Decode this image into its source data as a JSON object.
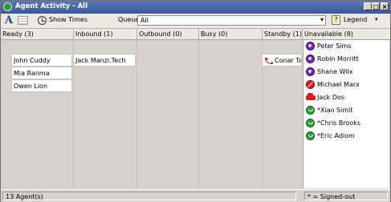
{
  "window": {
    "title": "Agent Activity - All",
    "controls": {
      "minimize": "_",
      "restore": "□",
      "close": "×"
    }
  },
  "toolbar": {
    "font_button": "A",
    "show_times_label": "Show Times",
    "queue_label": "Queue:",
    "queue_value": "All",
    "legend_label": "Legend",
    "legend_icon_glyph": "?",
    "dropdown_arrow": "▾"
  },
  "columns": [
    {
      "label": "Ready (3)",
      "agents": [
        "John Cuddy",
        "Mia Ranma",
        "Owen Lion"
      ]
    },
    {
      "label": "Inbound (1)",
      "agents": [
        "Jack Manzi.Tech"
      ]
    },
    {
      "label": "Outbound (0)",
      "agents": []
    },
    {
      "label": "Busy (0)",
      "agents": []
    },
    {
      "label": "Standby (1)",
      "agents": [
        {
          "name": "Conar Tannen",
          "icon": "phone-icon"
        }
      ]
    },
    {
      "label": "Unavailable (8)",
      "agents": [
        {
          "name": "Peter Sims",
          "icon": "away-purple-icon"
        },
        {
          "name": "Robin Morritt",
          "icon": "away-purple-icon"
        },
        {
          "name": "Shane Wilx",
          "icon": "away-purple-icon"
        },
        {
          "name": "Michael Marx",
          "icon": "do-not-disturb-icon"
        },
        {
          "name": "Jack Dos",
          "icon": "car-icon"
        },
        {
          "name": "*Xiao Simit",
          "icon": "signed-out-green-icon"
        },
        {
          "name": "*Chris Brooks",
          "icon": "signed-out-green-icon"
        },
        {
          "name": "*Eric Adiom",
          "icon": "signed-out-green-icon"
        }
      ]
    }
  ],
  "status_bar": {
    "agent_count": "13 Agent(s)",
    "signed_out_note": "* = Signed-out"
  }
}
